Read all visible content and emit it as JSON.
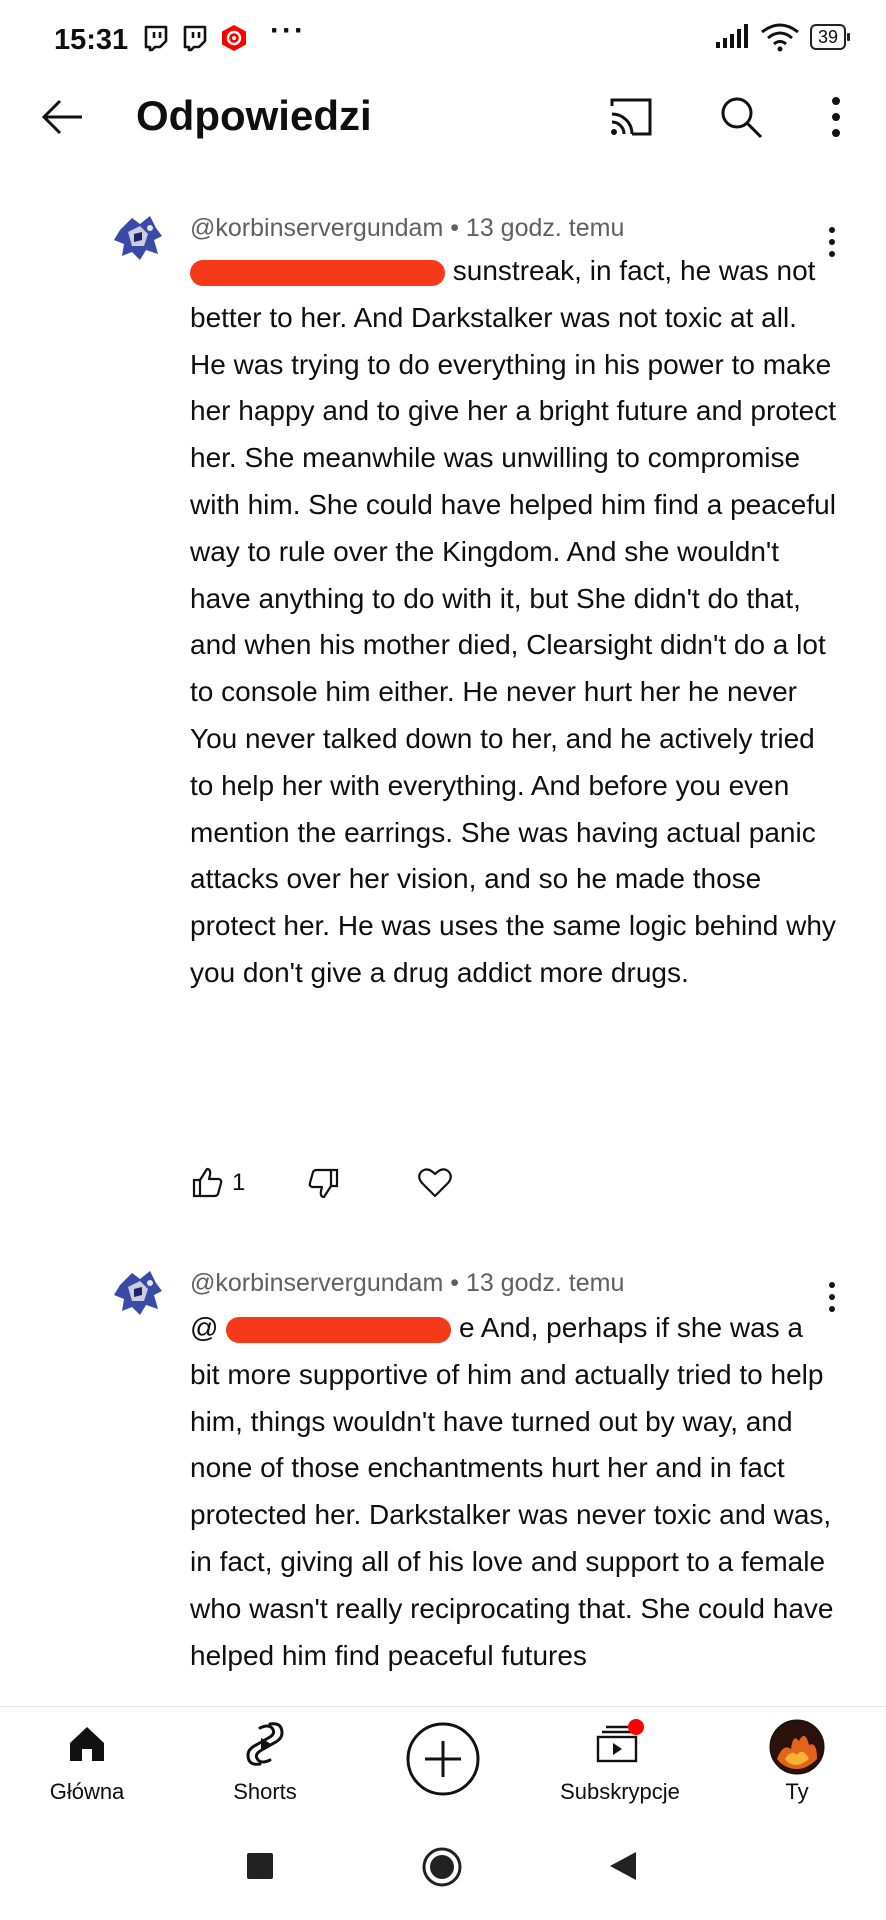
{
  "status_bar": {
    "time": "15:31",
    "battery": "39",
    "icons": [
      "twitch-icon",
      "twitch-icon",
      "youtube-icon",
      "more-dots",
      "signal-icon",
      "wifi-icon",
      "battery-icon"
    ]
  },
  "header": {
    "title": "Odpowiedzi",
    "icons": [
      "back-arrow-icon",
      "cast-icon",
      "search-icon",
      "more-vertical-icon"
    ]
  },
  "comments": [
    {
      "meta": "@korbinservergundam • 13 godz. temu",
      "mention_tail": "sunstreak, in fact, he was",
      "body": "not better to her. And Darkstalker was not toxic at all. He was trying to do everything in his power to make her happy and to give her a bright future and protect her. She meanwhile was unwilling to compromise with him. She could have helped him find a peaceful way to rule over the Kingdom. And she wouldn't have anything to do with it, but She didn't do that, and when his mother died, Clearsight didn't do a lot to console him either. He never hurt her he never You never talked down to her, and he actively tried to help her with everything. And before you even mention the earrings. She was having actual panic attacks over her vision, and so he made those protect her. He was uses the same logic behind why you don't give a drug addict more drugs.",
      "likes": "1"
    },
    {
      "meta": "@korbinservergundam • 13 godz. temu",
      "mention_prefix": "@",
      "mention_tail": "e  And, perhaps if she was a",
      "body": "bit more supportive of him and actually tried to help him, things wouldn't have turned out by way, and none of those enchantments hurt her and in fact protected her. Darkstalker was never toxic and was, in fact, giving all of his love and support to a female who wasn't really reciprocating that. She could have helped him find peaceful futures"
    }
  ],
  "bottom_nav": {
    "items": [
      {
        "label": "Główna",
        "icon": "home-icon"
      },
      {
        "label": "Shorts",
        "icon": "shorts-icon"
      },
      {
        "label": "",
        "icon": "create-plus-icon"
      },
      {
        "label": "Subskrypcje",
        "icon": "subscriptions-icon"
      },
      {
        "label": "Ty",
        "icon": "profile-avatar"
      }
    ]
  },
  "system_nav": [
    "recents-square-icon",
    "home-circle-icon",
    "back-triangle-icon"
  ],
  "colors": {
    "redaction": "#f53a1a",
    "notification_dot": "#ff0000",
    "meta_text": "#606060"
  }
}
